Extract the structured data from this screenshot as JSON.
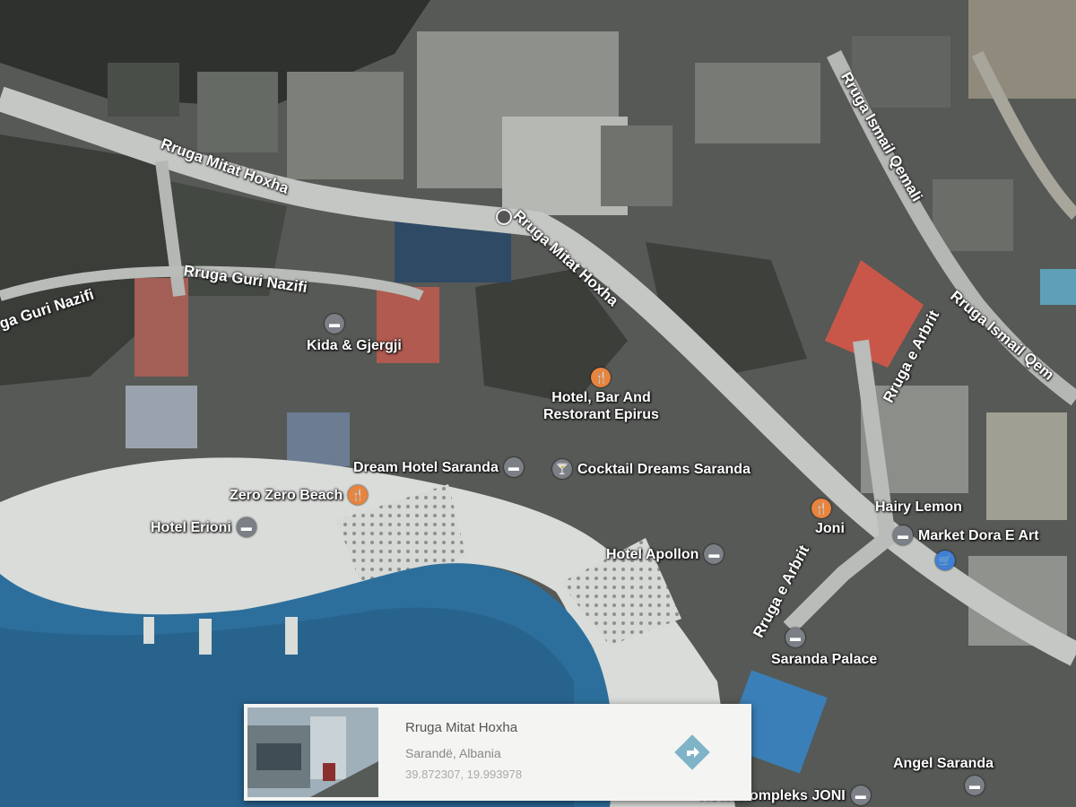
{
  "map": {
    "colors": {
      "water": "#2d6f9c",
      "beach": "#d9dcd8",
      "road": "#c9ccc8",
      "urban": "#3d3f3c",
      "roof_red": "#c8574a"
    },
    "streets": [
      {
        "name": "Rruga Mitat Hoxha"
      },
      {
        "name": "Rruga Mitat Hoxha"
      },
      {
        "name": "Rruga Guri Nazifi"
      },
      {
        "name": "ga Guri Nazifi"
      },
      {
        "name": "Rruga Ismail Qemali"
      },
      {
        "name": "Rruga Ismail Qem"
      },
      {
        "name": "Rruga e Arbrit"
      },
      {
        "name": "Rruga e Arbrit"
      }
    ],
    "pois": [
      {
        "name": "Kida & Gjergji",
        "icon": "bed-icon"
      },
      {
        "name": "Hotel, Bar And\nRestorant Epirus",
        "icon": "fork-knife-icon"
      },
      {
        "name": "Dream Hotel Saranda",
        "icon": "bed-icon"
      },
      {
        "name": "Cocktail Dreams Saranda",
        "icon": "cocktail-icon"
      },
      {
        "name": "Zero Zero Beach",
        "icon": "fork-knife-icon"
      },
      {
        "name": "Hotel Erioni",
        "icon": "bed-icon"
      },
      {
        "name": "Hotel Apollon",
        "icon": "bed-icon"
      },
      {
        "name": "Joni",
        "icon": "fork-knife-icon"
      },
      {
        "name": "Hairy Lemon",
        "icon": "none"
      },
      {
        "name": "Market Dora E Art",
        "icon": "bed-icon"
      },
      {
        "name": "",
        "icon": "shopping-cart-icon"
      },
      {
        "name": "Saranda Palace",
        "icon": "bed-icon"
      },
      {
        "name": "Angel Saranda",
        "icon": "bed-icon"
      },
      {
        "name": "Hotel Kompleks JONI",
        "icon": "bed-icon"
      }
    ]
  },
  "info_card": {
    "title": "Rruga Mitat Hoxha",
    "subtitle": "Sarandë, Albania",
    "coords": "39.872307, 19.993978",
    "directions_icon": "directions-arrow-icon"
  }
}
